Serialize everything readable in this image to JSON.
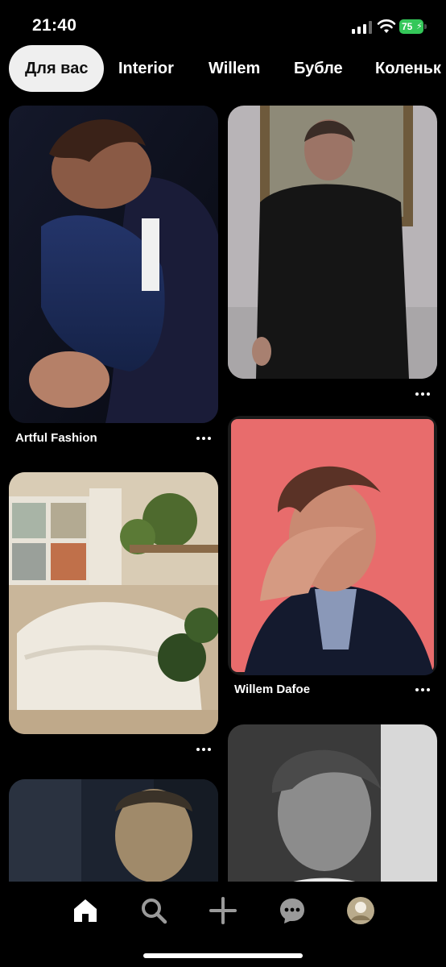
{
  "status": {
    "time": "21:40",
    "battery": "75"
  },
  "tabs": [
    {
      "label": "Для вас"
    },
    {
      "label": "Interior"
    },
    {
      "label": "Willem"
    },
    {
      "label": "Бубле"
    },
    {
      "label": "Коленьк"
    }
  ],
  "pins": [
    {
      "title": "Artful Fashion"
    },
    {
      "title": ""
    },
    {
      "title": "Willem Dafoe"
    },
    {
      "title": ""
    },
    {
      "title": ""
    },
    {
      "title": ""
    }
  ],
  "nav": {
    "items": [
      "home-icon",
      "search-icon",
      "create-icon",
      "messages-icon",
      "profile-avatar"
    ]
  },
  "colors": {
    "accent_battery": "#34c759",
    "active_tab_bg": "#efefef",
    "background": "#000000"
  }
}
